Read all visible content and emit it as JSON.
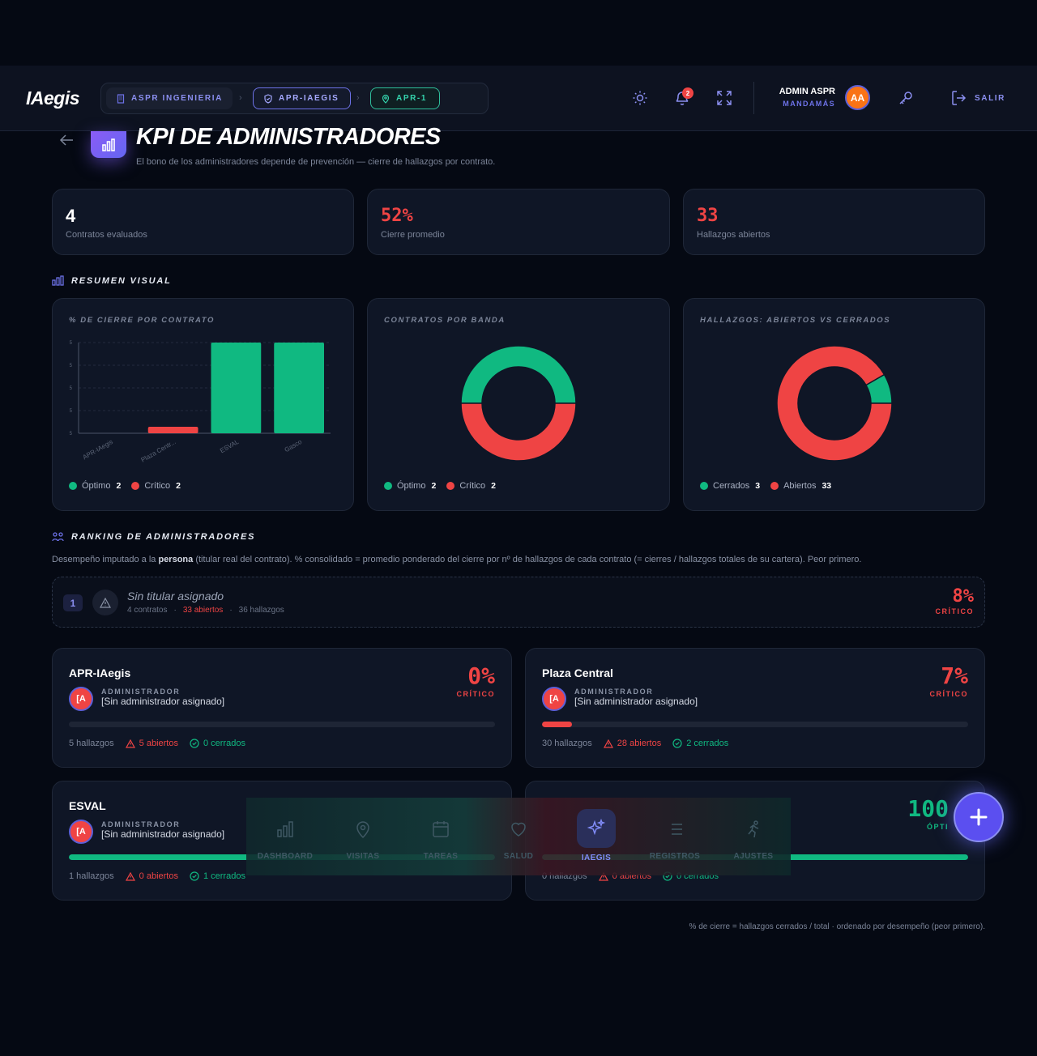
{
  "app": {
    "logo": "IAegis"
  },
  "breadcrumbs": [
    {
      "label": "ASPR INGENIERIA",
      "icon": "building-icon"
    },
    {
      "label": "APR-IAEGIS",
      "icon": "shield-icon"
    },
    {
      "label": "APR-1",
      "icon": "location-pin-icon"
    }
  ],
  "header": {
    "notifications_count": "2",
    "user_name": "ADMIN ASPR",
    "user_role": "MANDAMÁS",
    "user_initials": "AA",
    "logout_label": "SALIR"
  },
  "page": {
    "title": "KPI DE ADMINISTRADORES",
    "subtitle": "El bono de los administradores depende de prevención — cierre de hallazgos por contrato."
  },
  "stats": [
    {
      "value": "4",
      "label": "Contratos evaluados",
      "color": "#ffffff"
    },
    {
      "value": "52%",
      "label": "Cierre promedio",
      "color": "#ef4444"
    },
    {
      "value": "33",
      "label": "Hallazgos abiertos",
      "color": "#ef4444"
    }
  ],
  "summary": {
    "heading": "RESUMEN VISUAL"
  },
  "chart_data": [
    {
      "type": "bar",
      "title": "% DE CIERRE POR CONTRATO",
      "categories": [
        "APR-IAegis",
        "Plaza Centr...",
        "ESVAL",
        "Gasco"
      ],
      "values": [
        0,
        7,
        100,
        100
      ],
      "colors": [
        "#ef4444",
        "#ef4444",
        "#10b981",
        "#10b981"
      ],
      "ylim": [
        0,
        100
      ],
      "yticks": [
        "5",
        "5",
        "5",
        "5",
        "5"
      ],
      "grid": true,
      "legend": [
        {
          "label": "Óptimo",
          "count": "2",
          "color": "#10b981"
        },
        {
          "label": "Crítico",
          "count": "2",
          "color": "#ef4444"
        }
      ]
    },
    {
      "type": "pie",
      "title": "CONTRATOS POR BANDA",
      "series": [
        {
          "name": "Óptimo",
          "values": [
            2
          ],
          "color": "#10b981"
        },
        {
          "name": "Crítico",
          "values": [
            2
          ],
          "color": "#ef4444"
        }
      ],
      "legend": [
        {
          "label": "Óptimo",
          "count": "2",
          "color": "#10b981"
        },
        {
          "label": "Crítico",
          "count": "2",
          "color": "#ef4444"
        }
      ]
    },
    {
      "type": "pie",
      "title": "HALLAZGOS: ABIERTOS VS CERRADOS",
      "series": [
        {
          "name": "Cerrados",
          "values": [
            3
          ],
          "color": "#10b981"
        },
        {
          "name": "Abiertos",
          "values": [
            33
          ],
          "color": "#ef4444"
        }
      ],
      "legend": [
        {
          "label": "Cerrados",
          "count": "3",
          "color": "#10b981"
        },
        {
          "label": "Abiertos",
          "count": "33",
          "color": "#ef4444"
        }
      ]
    }
  ],
  "ranking": {
    "heading": "RANKING DE ADMINISTRADORES",
    "desc_before": "Desempeño imputado a la ",
    "desc_bold": "persona",
    "desc_after": " (titular real del contrato). % consolidado = promedio ponderado del cierre por nº de hallazgos de cada contrato (= cierres / hallazgos totales de su cartera). Peor primero.",
    "rows": [
      {
        "rank": "1",
        "name": "Sin titular asignado",
        "contracts": "4 contratos",
        "open": "33 abiertos",
        "findings": "36 hallazgos",
        "pct": "8%",
        "band": "CRÍTICO"
      }
    ]
  },
  "contracts": [
    {
      "name": "APR-IAegis",
      "initials": "[A",
      "role": "ADMINISTRADOR",
      "admin": "[Sin administrador asignado]",
      "pct": "0%",
      "band": "CRÍTICO",
      "band_color": "#ef4444",
      "progress": 0,
      "findings": "5 hallazgos",
      "open": "5 abiertos",
      "closed": "0 cerrados"
    },
    {
      "name": "Plaza Central",
      "initials": "[A",
      "role": "ADMINISTRADOR",
      "admin": "[Sin administrador asignado]",
      "pct": "7%",
      "band": "CRÍTICO",
      "band_color": "#ef4444",
      "progress": 7,
      "findings": "30 hallazgos",
      "open": "28 abiertos",
      "closed": "2 cerrados"
    },
    {
      "name": "ESVAL",
      "initials": "[A",
      "role": "ADMINISTRADOR",
      "admin": "[Sin administrador asignado]",
      "pct": "",
      "band": "",
      "band_color": "#10b981",
      "progress": 100,
      "findings": "1 hallazgos",
      "open": "0 abiertos",
      "closed": "1 cerrados"
    },
    {
      "name": "",
      "initials": "",
      "role": "",
      "admin": "",
      "pct": "100",
      "band": "ÓPTI",
      "band_color": "#10b981",
      "progress": 100,
      "findings": "0 hallazgos",
      "open": "0 abiertos",
      "closed": "0 cerrados"
    }
  ],
  "footnote": "% de cierre = hallazgos cerrados / total · ordenado por desempeño (peor primero).",
  "bottom_nav": [
    {
      "label": "DASHBOARD",
      "icon": "bar-chart-icon"
    },
    {
      "label": "VISITAS",
      "icon": "location-pin-icon"
    },
    {
      "label": "TAREAS",
      "icon": "calendar-icon"
    },
    {
      "label": "SALUD",
      "icon": "heart-icon"
    },
    {
      "label": "IAEGIS",
      "icon": "sparkles-icon",
      "active": true
    },
    {
      "label": "REGISTROS",
      "icon": "list-icon"
    },
    {
      "label": "AJUSTES",
      "icon": "runner-icon"
    }
  ],
  "colors": {
    "accent": "#6366f1",
    "critical": "#ef4444",
    "optimal": "#10b981"
  }
}
